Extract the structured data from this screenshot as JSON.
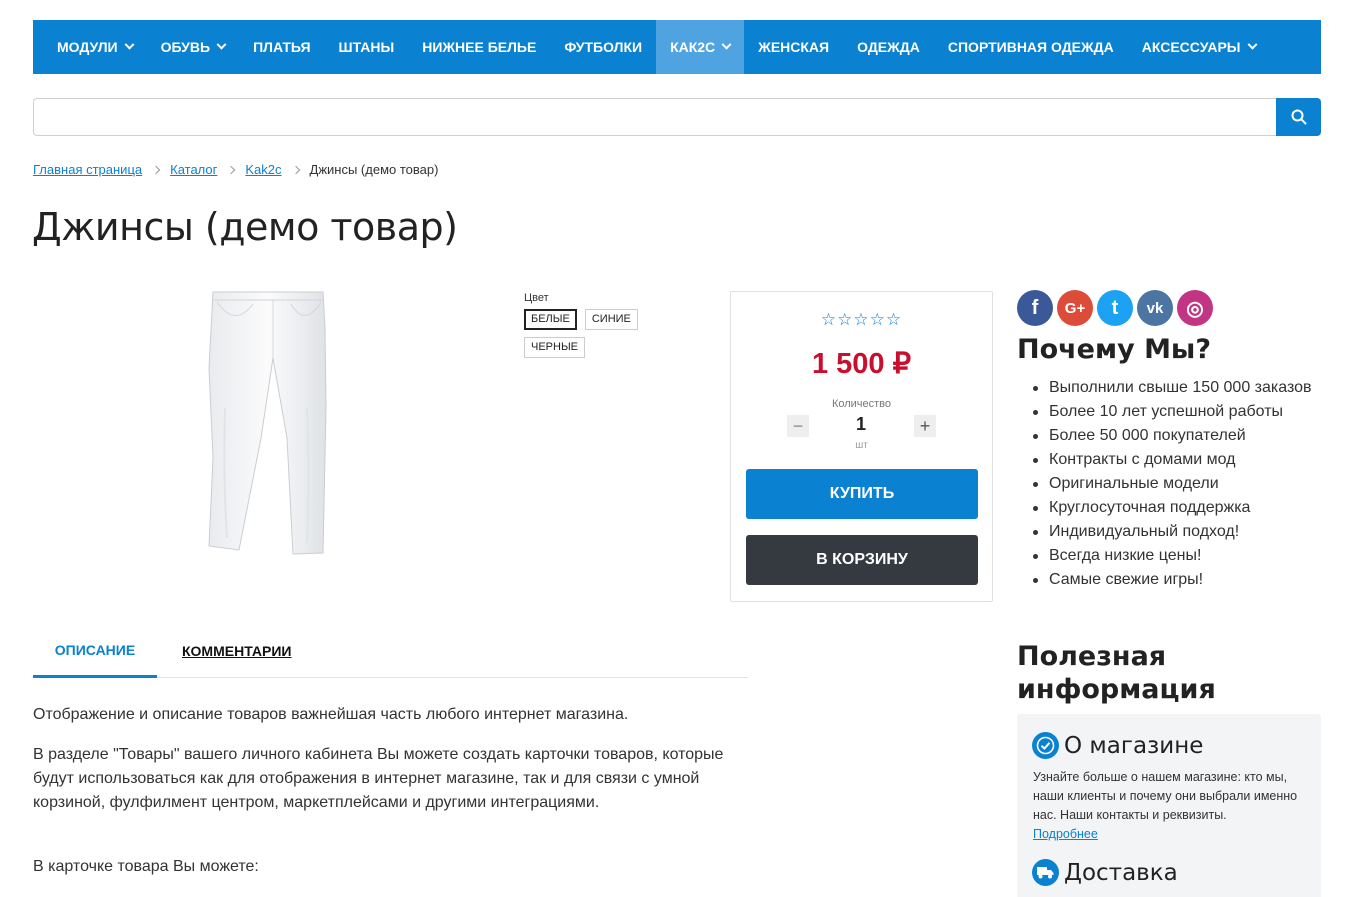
{
  "nav": {
    "items": [
      {
        "label": "МОДУЛИ",
        "dropdown": true
      },
      {
        "label": "ОБУВЬ",
        "dropdown": true
      },
      {
        "label": "ПЛАТЬЯ"
      },
      {
        "label": "ШТАНЫ"
      },
      {
        "label": "НИЖНЕЕ БЕЛЬЕ"
      },
      {
        "label": "ФУТБОЛКИ"
      },
      {
        "label": "КАК2С",
        "dropdown": true,
        "active": true
      },
      {
        "label": "ЖЕНСКАЯ"
      },
      {
        "label": "ОДЕЖДА"
      },
      {
        "label": "СПОРТИВНАЯ ОДЕЖДА"
      },
      {
        "label": "АКСЕССУАРЫ",
        "dropdown": true
      }
    ]
  },
  "search": {
    "value": "",
    "placeholder": "",
    "icon": "search-icon"
  },
  "breadcrumb": {
    "items": [
      "Главная страница",
      "Каталог",
      "Kak2c"
    ],
    "current": "Джинсы (демо товар)"
  },
  "product": {
    "title": "Джинсы (демо товар)",
    "color_label": "Цвет",
    "colors": [
      "БЕЛЫЕ",
      "СИНИЕ",
      "ЧЕРНЫЕ"
    ],
    "selected_color": "БЕЛЫЕ",
    "rating_stars": "☆☆☆☆☆",
    "price": "1 500 ₽",
    "quantity_label": "Количество",
    "quantity": "1",
    "quantity_unit": "шт",
    "buy_label": "КУПИТЬ",
    "cart_label": "В КОРЗИНУ"
  },
  "social": [
    {
      "name": "facebook-icon",
      "glyph": "f",
      "color": "#3b5998"
    },
    {
      "name": "google-plus-icon",
      "glyph": "G+",
      "color": "#dd4b39"
    },
    {
      "name": "twitter-icon",
      "glyph": "t",
      "color": "#1da1f2"
    },
    {
      "name": "vk-icon",
      "glyph": "vk",
      "color": "#4c75a3"
    },
    {
      "name": "instagram-icon",
      "glyph": "◎",
      "color": "#c13584"
    }
  ],
  "why": {
    "title": "Почему Мы?",
    "items": [
      "Выполнили свыше 150 000 заказов",
      "Более 10 лет успешной работы",
      "Более 50 000 покупателей",
      "Контракты с домами мод",
      "Оригинальные модели",
      "Круглосуточная поддержка",
      "Индивидуальный подход!",
      "Всегда низкие цены!",
      "Самые свежие игры!"
    ]
  },
  "tabs": {
    "description": "ОПИСАНИЕ",
    "comments": "КОММЕНТАРИИ"
  },
  "description": {
    "p1": "Отображение и описание товаров важнейшая часть любого интернет магазина.",
    "p2": "В разделе \"Товары\" вашего личного кабинета Вы можете создать карточки товаров, которые будут использоваться как для отображения в интернет магазине, так и для связи с умной корзиной, фулфилмент центром, маркетплейсами и другими интеграциями.",
    "p3": "В карточке товара Вы можете:"
  },
  "useful": {
    "title": "Полезная информация",
    "about_title": "О магазине",
    "about_text": "Узнайте больше о нашем магазине: кто мы, наши клиенты и почему они выбрали именно нас. Наши контакты и реквизиты.",
    "about_link": "Подробнее",
    "delivery_title": "Доставка"
  },
  "colors": {
    "accent": "#0a81d1",
    "price": "#c8102e",
    "cart_button": "#343a40"
  }
}
